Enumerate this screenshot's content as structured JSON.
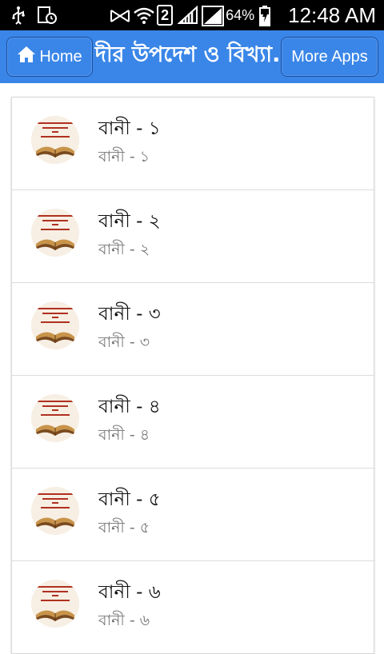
{
  "status_bar": {
    "sim_label": "2",
    "battery_percent": "64%",
    "time": "12:48 AM"
  },
  "header": {
    "home_label": "Home",
    "title": "...দীর উপদেশ ও বিখ্যা...",
    "more_label": "More Apps"
  },
  "items": [
    {
      "title": "বানী - ১",
      "subtitle": "বানী - ১"
    },
    {
      "title": "বানী - ২",
      "subtitle": "বানী - ২"
    },
    {
      "title": "বানী - ৩",
      "subtitle": "বানী - ৩"
    },
    {
      "title": "বানী - ৪",
      "subtitle": "বানী - ৪"
    },
    {
      "title": "বানী - ৫",
      "subtitle": "বানী - ৫"
    },
    {
      "title": "বানী - ৬",
      "subtitle": "বানী - ৬"
    }
  ],
  "colors": {
    "appbar": "#3a86e8",
    "status_bar": "#000000"
  }
}
